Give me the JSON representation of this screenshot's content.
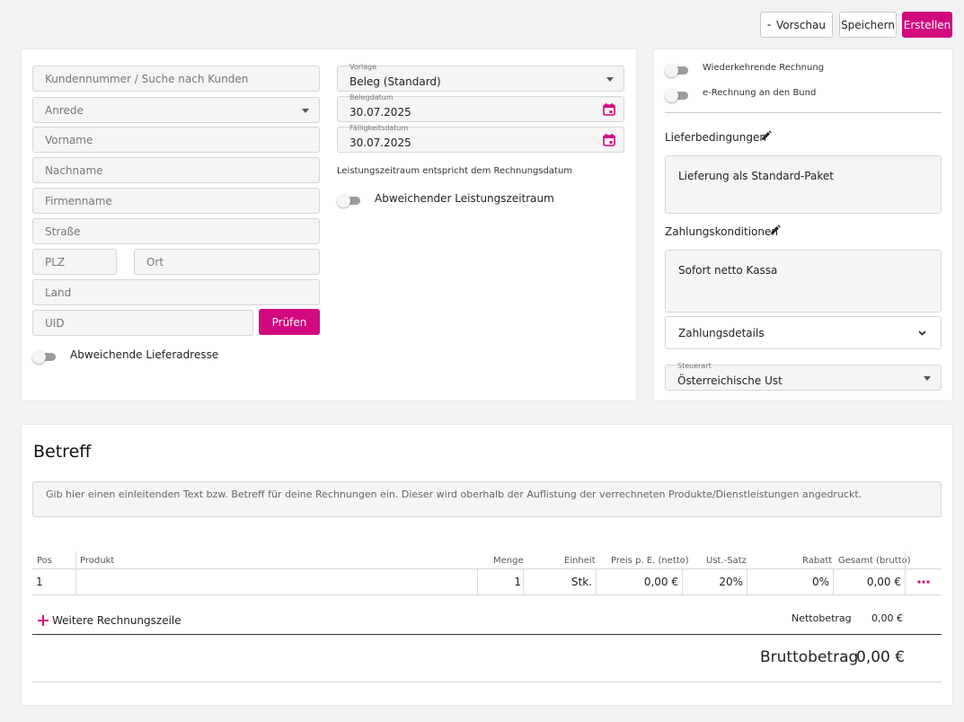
{
  "toolbar": {
    "preview_label": "Vorschau",
    "save_label": "Speichern",
    "create_label": "Erstellen"
  },
  "customer": {
    "search_placeholder": "Kundennummer / Suche nach Kunden",
    "salutation_placeholder": "Anrede",
    "firstname_placeholder": "Vorname",
    "lastname_placeholder": "Nachname",
    "company_placeholder": "Firmenname",
    "street_placeholder": "Straße",
    "zip_placeholder": "PLZ",
    "city_placeholder": "Ort",
    "country_placeholder": "Land",
    "uid_placeholder": "UID",
    "check_label": "Prüfen",
    "alt_delivery_label": "Abweichende Lieferadresse"
  },
  "document": {
    "template_label": "Vorlage",
    "template_value": "Beleg (Standard)",
    "date_label": "Belegdatum",
    "date_value": "30.07.2025",
    "due_label": "Fälligkeitsdatum",
    "due_value": "30.07.2025",
    "period_note": "Leistungszeitraum entspricht dem Rechnungsdatum",
    "alt_period_label": "Abweichender Leistungszeitraum"
  },
  "settings": {
    "recurring_label": "Wiederkehrende Rechnung",
    "erechnung_label": "e-Rechnung an den Bund",
    "delivery_terms_title": "Lieferbedingungen",
    "delivery_terms_value": "Lieferung als Standard-Paket",
    "payment_terms_title": "Zahlungskonditionen",
    "payment_terms_value": "Sofort netto Kassa",
    "payment_details_label": "Zahlungsdetails",
    "tax_label": "Steuerart",
    "tax_value": "Österreichische Ust"
  },
  "subject": {
    "title": "Betreff",
    "placeholder": "Gib hier einen einleitenden Text bzw. Betreff für deine Rechnungen ein. Dieser wird oberhalb der Auflistung der verrechneten Produkte/Dienstleistungen angedruckt."
  },
  "table": {
    "headers": {
      "pos": "Pos",
      "product": "Produkt",
      "qty": "Menge",
      "unit": "Einheit",
      "price": "Preis p. E. (netto)",
      "vat": "Ust.-Satz",
      "discount": "Rabatt",
      "total": "Gesamt (brutto)"
    },
    "rows": [
      {
        "pos": "1",
        "product": "",
        "qty": "1",
        "unit": "Stk.",
        "price": "0,00 €",
        "vat": "20%",
        "discount": "0%",
        "total": "0,00 €"
      }
    ],
    "add_row_label": "Weitere Rechnungszeile",
    "net_label": "Nettobetrag",
    "net_value": "0,00 €",
    "gross_label": "Bruttobetrag",
    "gross_value": "0,00 €"
  },
  "colors": {
    "accent": "#d1087e"
  }
}
